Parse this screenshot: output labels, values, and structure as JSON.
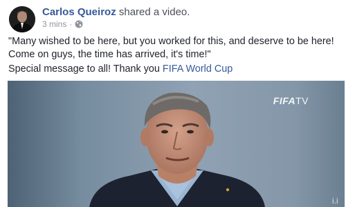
{
  "post": {
    "author": "Carlos Queiroz",
    "action": "shared a video.",
    "time": "3 mins",
    "separator": "·",
    "privacy_icon": "globe-icon",
    "quote": "\"Many wished to be here, but you worked for this, and deserve to be here! Come on guys, the time has arrived, it's time!\"",
    "message_prefix": "Special message to all! Thank you",
    "message_link": "FIFA World Cup"
  },
  "video": {
    "watermark_brand": "FIFA",
    "watermark_suffix": "TV"
  },
  "colors": {
    "author": "#365899",
    "link": "#365899",
    "meta": "#90949c",
    "text": "#1d2129"
  }
}
